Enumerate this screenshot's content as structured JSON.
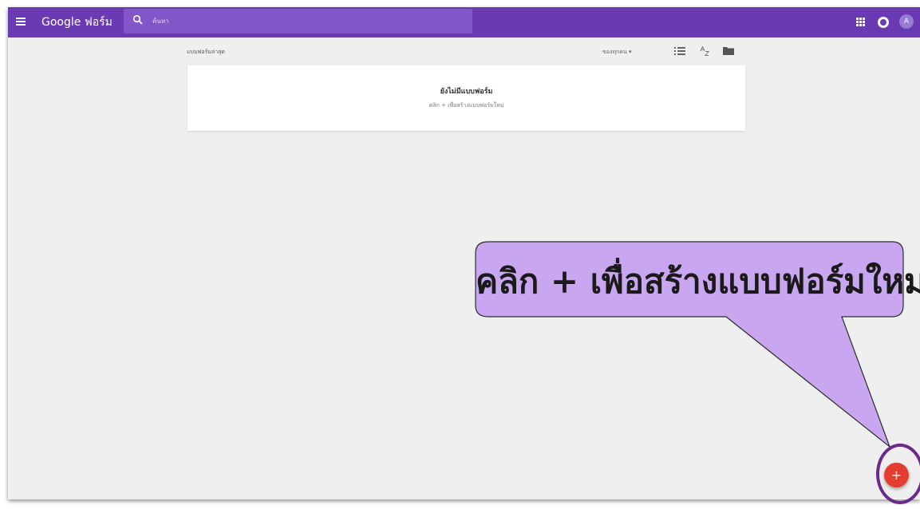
{
  "header": {
    "brand": "Google ฟอร์ม",
    "search_placeholder": "ค้นหา",
    "avatar_letter": "A"
  },
  "toolbar": {
    "section_title": "แบบฟอร์มล่าสุด",
    "owner_filter": "ของทุกคน ▾"
  },
  "empty_state": {
    "title": "ยังไม่มีแบบฟอร์ม",
    "hint": "คลิก + เพื่อสร้างแบบฟอร์มใหม่"
  },
  "fab": {
    "label": "+"
  },
  "callout": {
    "text": "คลิก + เพื่อสร้างแบบฟอร์มใหม่"
  },
  "colors": {
    "topbar": "#6a3ab3",
    "fab": "#e53c31",
    "callout_fill": "#c9a6f0"
  },
  "icons": [
    "menu-icon",
    "search-icon",
    "list-view-icon",
    "sort-az-icon",
    "folder-icon",
    "apps-icon",
    "notification-icon"
  ]
}
